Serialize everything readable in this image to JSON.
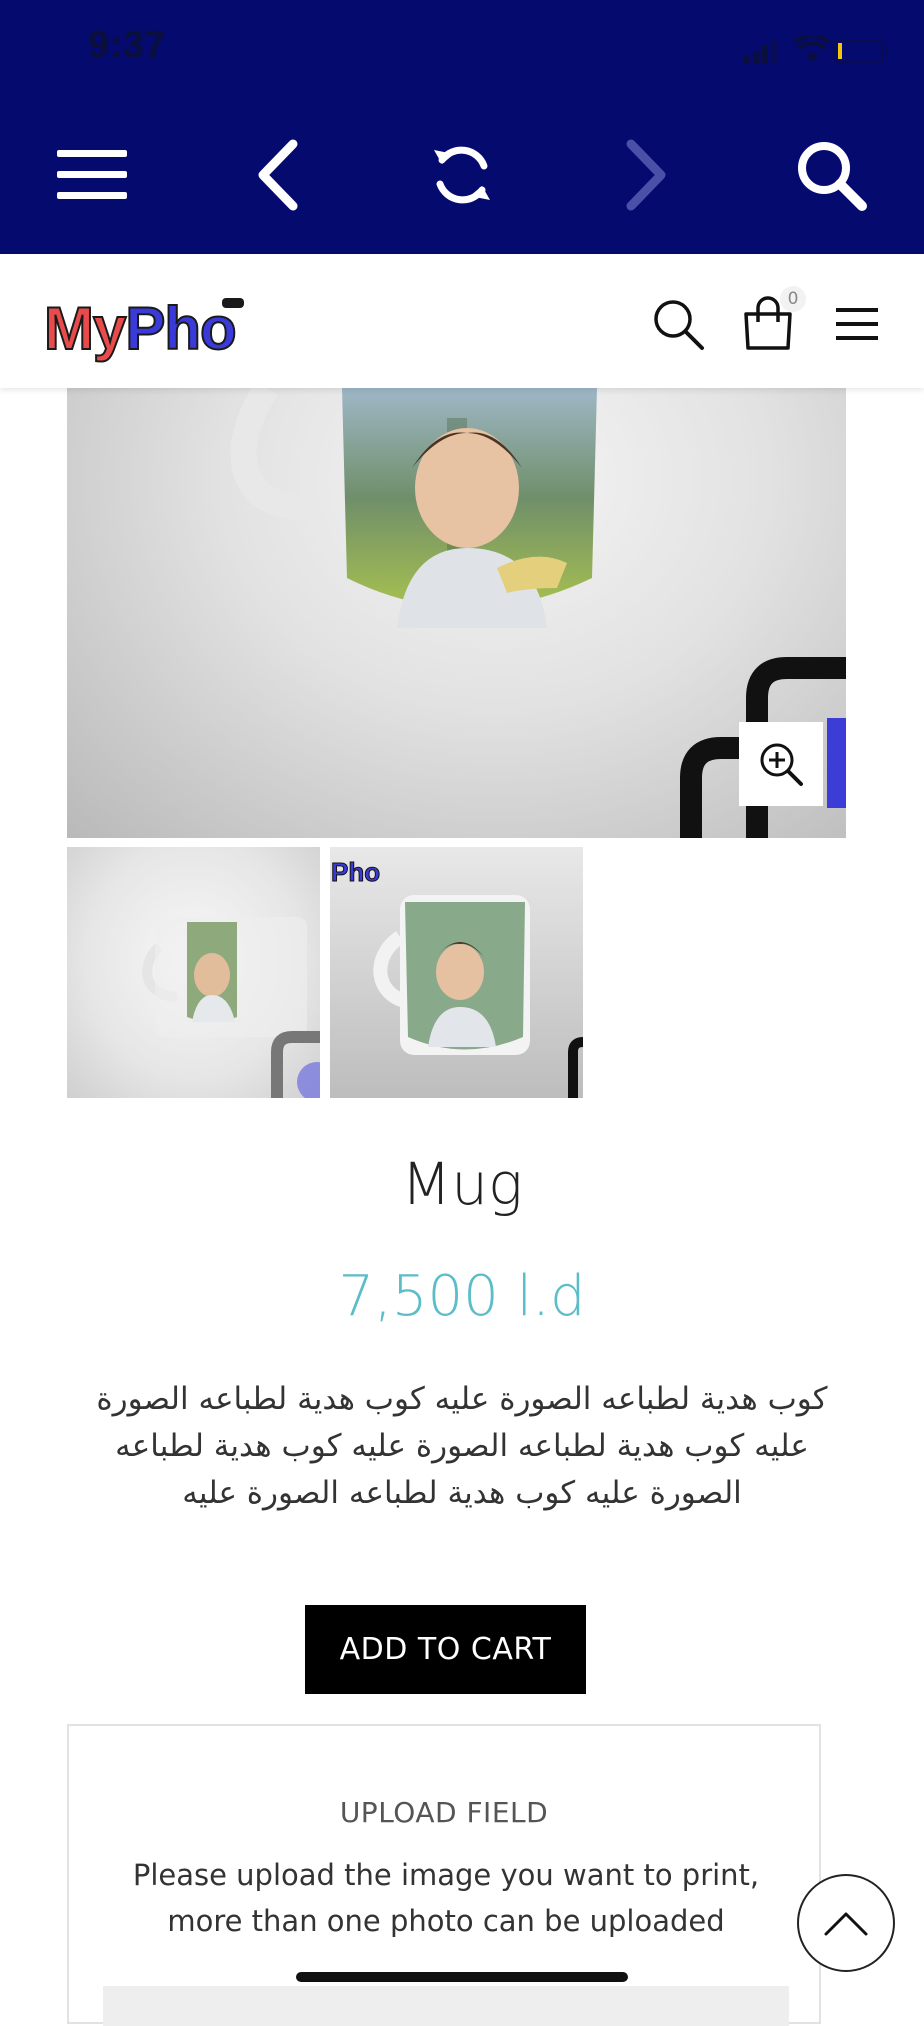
{
  "status_bar": {
    "time": "9:37"
  },
  "brand": {
    "logo_my": "My",
    "logo_pho": "Pho",
    "thumb_logo": "Pho"
  },
  "cart": {
    "count": "0"
  },
  "product": {
    "title": "Mug",
    "price": "7,500 l.d",
    "description": "كوب هدية لطباعه الصورة عليه كوب هدية لطباعه الصورة عليه  كوب هدية لطباعه الصورة عليه كوب هدية لطباعه الصورة عليه كوب هدية لطباعه الصورة عليه"
  },
  "actions": {
    "add_to_cart": "ADD TO CART"
  },
  "upload": {
    "title": "UPLOAD FIELD",
    "description": "Please upload the image you want to print, more than one photo can be uploaded"
  },
  "icons": {
    "toolbar": [
      "menu-icon",
      "back-icon",
      "reload-icon",
      "forward-icon",
      "search-icon"
    ],
    "header": [
      "search-icon",
      "cart-icon",
      "menu-icon"
    ]
  },
  "colors": {
    "toolbar_bg": "#050a6f",
    "price": "#5bbdc7",
    "button_bg": "#000000"
  }
}
